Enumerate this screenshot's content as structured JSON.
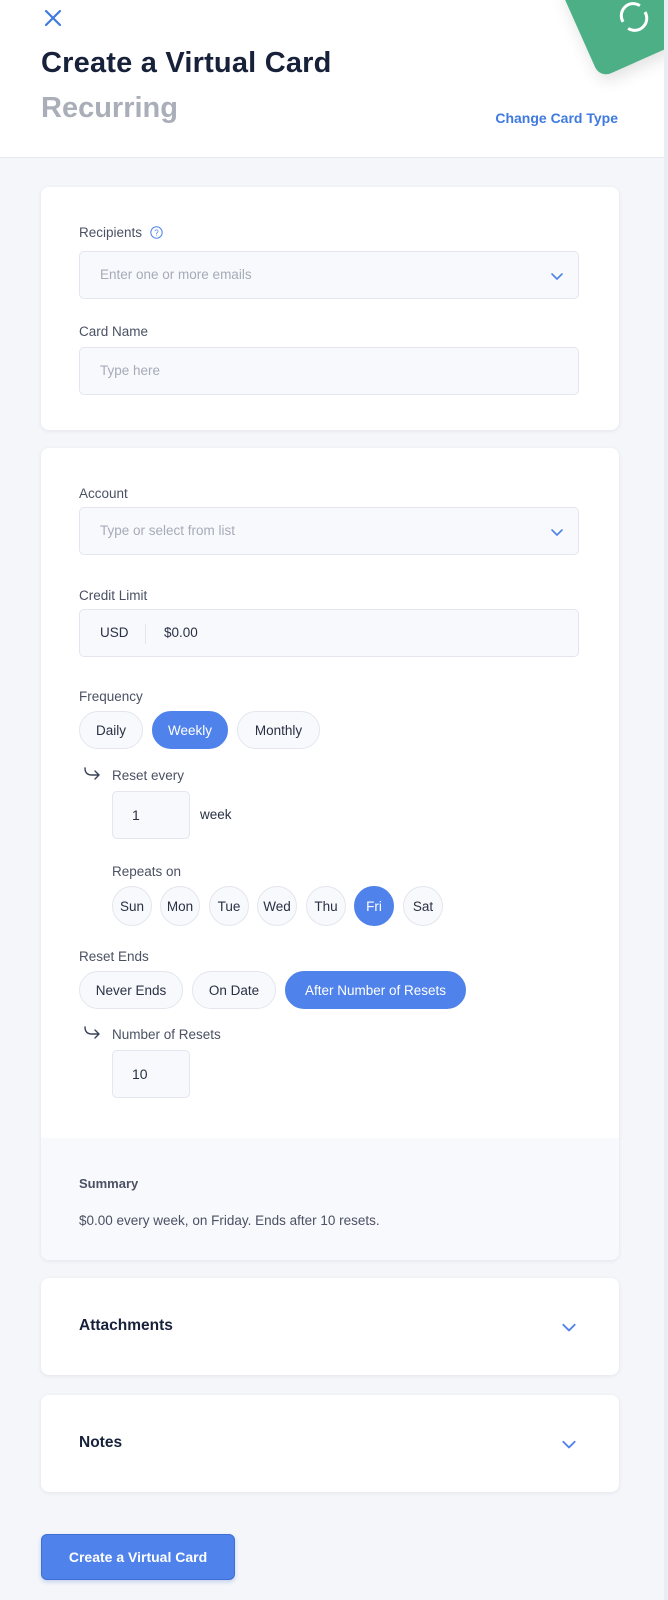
{
  "header": {
    "title": "Create a Virtual Card",
    "subtitle": "Recurring",
    "change_card_type": "Change Card Type"
  },
  "recipients": {
    "label": "Recipients",
    "placeholder": "Enter one or more emails"
  },
  "card_name": {
    "label": "Card Name",
    "placeholder": "Type here"
  },
  "account": {
    "label": "Account",
    "placeholder": "Type or select from list"
  },
  "credit_limit": {
    "label": "Credit Limit",
    "currency": "USD",
    "value": "$0.00"
  },
  "frequency": {
    "label": "Frequency",
    "options": [
      "Daily",
      "Weekly",
      "Monthly"
    ],
    "selected": "Weekly"
  },
  "reset_every": {
    "label": "Reset every",
    "value": "1",
    "unit": "week"
  },
  "repeats_on": {
    "label": "Repeats on",
    "days": [
      "Sun",
      "Mon",
      "Tue",
      "Wed",
      "Thu",
      "Fri",
      "Sat"
    ],
    "selected": "Fri"
  },
  "reset_ends": {
    "label": "Reset Ends",
    "options": [
      "Never Ends",
      "On Date",
      "After Number of Resets"
    ],
    "selected": "After Number of Resets"
  },
  "number_of_resets": {
    "label": "Number of Resets",
    "value": "10"
  },
  "summary": {
    "title": "Summary",
    "text": "$0.00 every week, on Friday. Ends after 10 resets."
  },
  "attachments": {
    "title": "Attachments"
  },
  "notes": {
    "title": "Notes"
  },
  "submit_label": "Create a Virtual Card",
  "colors": {
    "accent": "#4f82ea",
    "link": "#3f7ae0",
    "deco_card": "#4caf86"
  }
}
